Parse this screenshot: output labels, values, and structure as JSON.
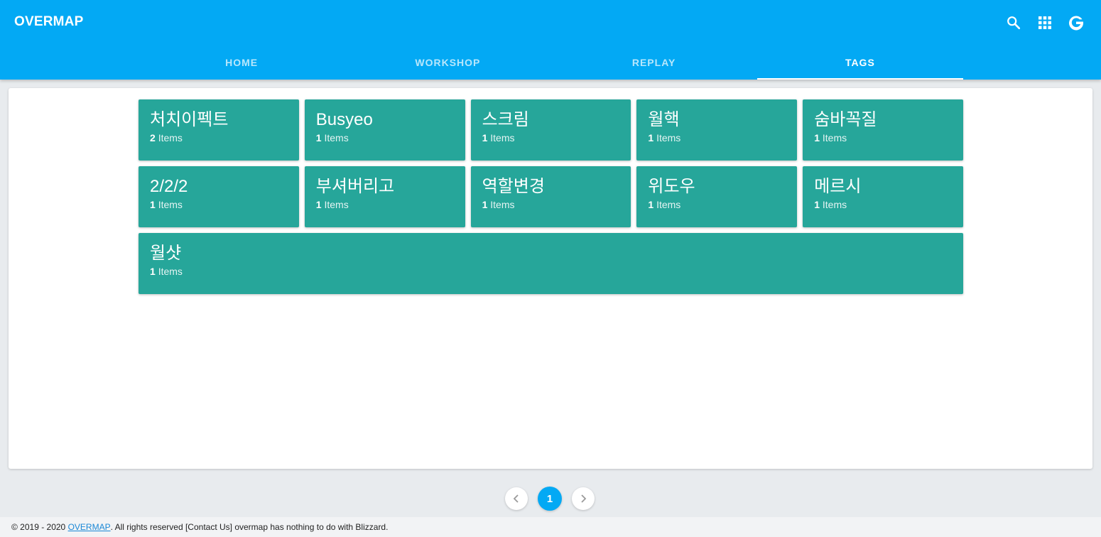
{
  "header": {
    "brand": "OVERMAP",
    "tabs": [
      {
        "label": "HOME"
      },
      {
        "label": "WORKSHOP"
      },
      {
        "label": "REPLAY"
      },
      {
        "label": "TAGS"
      }
    ],
    "active_tab": "TAGS",
    "icons": [
      "search-icon",
      "apps-grid-icon",
      "google-icon"
    ]
  },
  "tags": [
    {
      "name": "처치이펙트",
      "count": "2",
      "unit": "Items"
    },
    {
      "name": "Busyeo",
      "count": "1",
      "unit": "Items"
    },
    {
      "name": "스크림",
      "count": "1",
      "unit": "Items"
    },
    {
      "name": "월핵",
      "count": "1",
      "unit": "Items"
    },
    {
      "name": "숨바꼭질",
      "count": "1",
      "unit": "Items"
    },
    {
      "name": "2/2/2",
      "count": "1",
      "unit": "Items"
    },
    {
      "name": "부셔버리고",
      "count": "1",
      "unit": "Items"
    },
    {
      "name": "역할변경",
      "count": "1",
      "unit": "Items"
    },
    {
      "name": "위도우",
      "count": "1",
      "unit": "Items"
    },
    {
      "name": "메르시",
      "count": "1",
      "unit": "Items"
    },
    {
      "name": "월샷",
      "count": "1",
      "unit": "Items"
    }
  ],
  "pagination": {
    "current_page": "1",
    "icons": [
      "chevron-left-icon",
      "chevron-right-icon"
    ]
  },
  "footer": {
    "prefix": "© 2019 - 2020 ",
    "link": "OVERMAP",
    "suffix": ". All rights reserved [Contact Us] overmap has nothing to do with Blizzard."
  },
  "colors": {
    "appbar": "#03a9f4",
    "tag_card": "#26a69a",
    "page_bg": "#e8ebee"
  }
}
